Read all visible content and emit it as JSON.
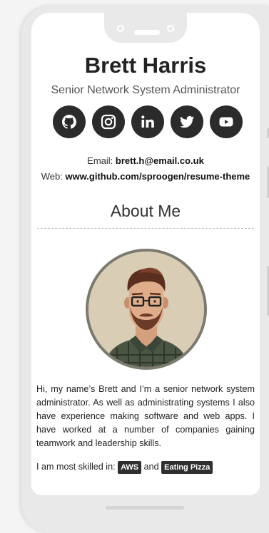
{
  "profile": {
    "name": "Brett Harris",
    "title": "Senior Network System Administrator"
  },
  "socials": [
    {
      "icon": "github-icon"
    },
    {
      "icon": "instagram-icon"
    },
    {
      "icon": "linkedin-icon"
    },
    {
      "icon": "twitter-icon"
    },
    {
      "icon": "youtube-icon"
    }
  ],
  "contact": {
    "email_label": "Email:",
    "email": "brett.h@email.co.uk",
    "web_label": "Web:",
    "web": "www.github.com/sproogen/resume-theme"
  },
  "about": {
    "heading": "About Me",
    "bio": "Hi, my name’s Brett and I’m a senior network system administrator. As well as administrating systems I also have experience making software and web apps. I have worked at a number of companies gaining teamwork and leadership skills.",
    "skills_prefix": "I am most skilled in:",
    "skill_1": "AWS",
    "skills_joiner": "and",
    "skill_2": "Eating Pizza"
  },
  "colors": {
    "icon_bg": "#2b2b2b",
    "tag_bg": "#2f2f2f"
  }
}
